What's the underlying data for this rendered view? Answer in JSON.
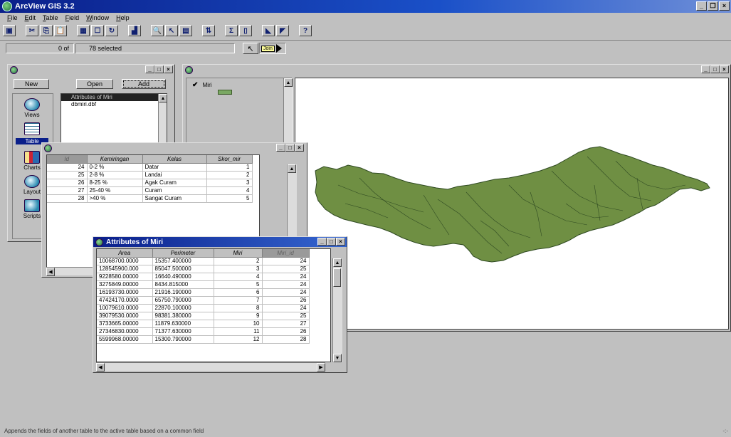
{
  "app": {
    "title": "ArcView GIS 3.2"
  },
  "menu": [
    "File",
    "Edit",
    "Table",
    "Field",
    "Window",
    "Help"
  ],
  "toolbar": {
    "icons": [
      "save-icon",
      "cut-icon",
      "copy-icon",
      "paste-icon",
      "table-icon",
      "select-all-icon",
      "refresh-icon",
      "chart-icon",
      "find-icon",
      "query-icon",
      "promote-icon",
      "sort-icon",
      "sum-icon",
      "statistics-icon",
      "select-icon",
      "flag-icon",
      "help-icon"
    ],
    "glyphs": [
      "▣",
      "✂",
      "⎘",
      "📋",
      "▦",
      "☐",
      "↻",
      "▟",
      "🔍",
      "↖",
      "▤",
      "⇅",
      "Σ",
      "▯",
      "◣",
      "◤",
      "?"
    ]
  },
  "selection": {
    "count_label": "0 of",
    "total_label": "78 selected"
  },
  "join_tool": {
    "tooltip": "Join"
  },
  "project": {
    "new_label": "New",
    "open_label": "Open",
    "add_label": "Add",
    "doc_types": [
      "Views",
      "Tables",
      "Charts",
      "Layouts",
      "Scripts"
    ],
    "doc_labels": [
      "Views",
      "Table",
      "Charts",
      "Layout",
      "Scripts"
    ],
    "tables": [
      "Attributes of Miri",
      "dbmiri.dbf"
    ]
  },
  "view": {
    "layer_name": "Miri",
    "layer_color": "#7aa863",
    "map_fill": "#6f8f43",
    "map_stroke": "#2f4a22"
  },
  "kemiringan": {
    "columns": [
      "Id",
      "Kemiringan",
      "Kelas",
      "Skor_mir"
    ],
    "rows": [
      [
        "24",
        "0-2 %",
        "Datar",
        "1"
      ],
      [
        "25",
        "2-8 %",
        "Landai",
        "2"
      ],
      [
        "26",
        "8-25 %",
        "Agak Curam",
        "3"
      ],
      [
        "27",
        "25-40 %",
        "Curam",
        "4"
      ],
      [
        "28",
        ">40 %",
        "Sangat Curam",
        "5"
      ]
    ]
  },
  "attributes": {
    "title": "Attributes of Miri",
    "columns": [
      "Area",
      "Perimeter",
      "Miri",
      "Miri_id"
    ],
    "rows": [
      [
        "10068700.0000",
        "15357.400000",
        "2",
        "24"
      ],
      [
        "128545900.000",
        "85047.500000",
        "3",
        "25"
      ],
      [
        "9228580.00000",
        "16640.490000",
        "4",
        "24"
      ],
      [
        "3275849.00000",
        "8434.815000",
        "5",
        "24"
      ],
      [
        "16193730.0000",
        "21916.190000",
        "6",
        "24"
      ],
      [
        "47424170.0000",
        "65750.790000",
        "7",
        "26"
      ],
      [
        "10079610.0000",
        "22870.100000",
        "8",
        "24"
      ],
      [
        "39079530.0000",
        "98381.380000",
        "9",
        "25"
      ],
      [
        "3733665.00000",
        "11879.630000",
        "10",
        "27"
      ],
      [
        "27346830.0000",
        "71377.630000",
        "11",
        "26"
      ],
      [
        "5599968.00000",
        "15300.790000",
        "12",
        "28"
      ]
    ]
  },
  "statusbar": {
    "message": "Appends the fields of another table to the active table based on a common field",
    "corner": "-:-"
  }
}
